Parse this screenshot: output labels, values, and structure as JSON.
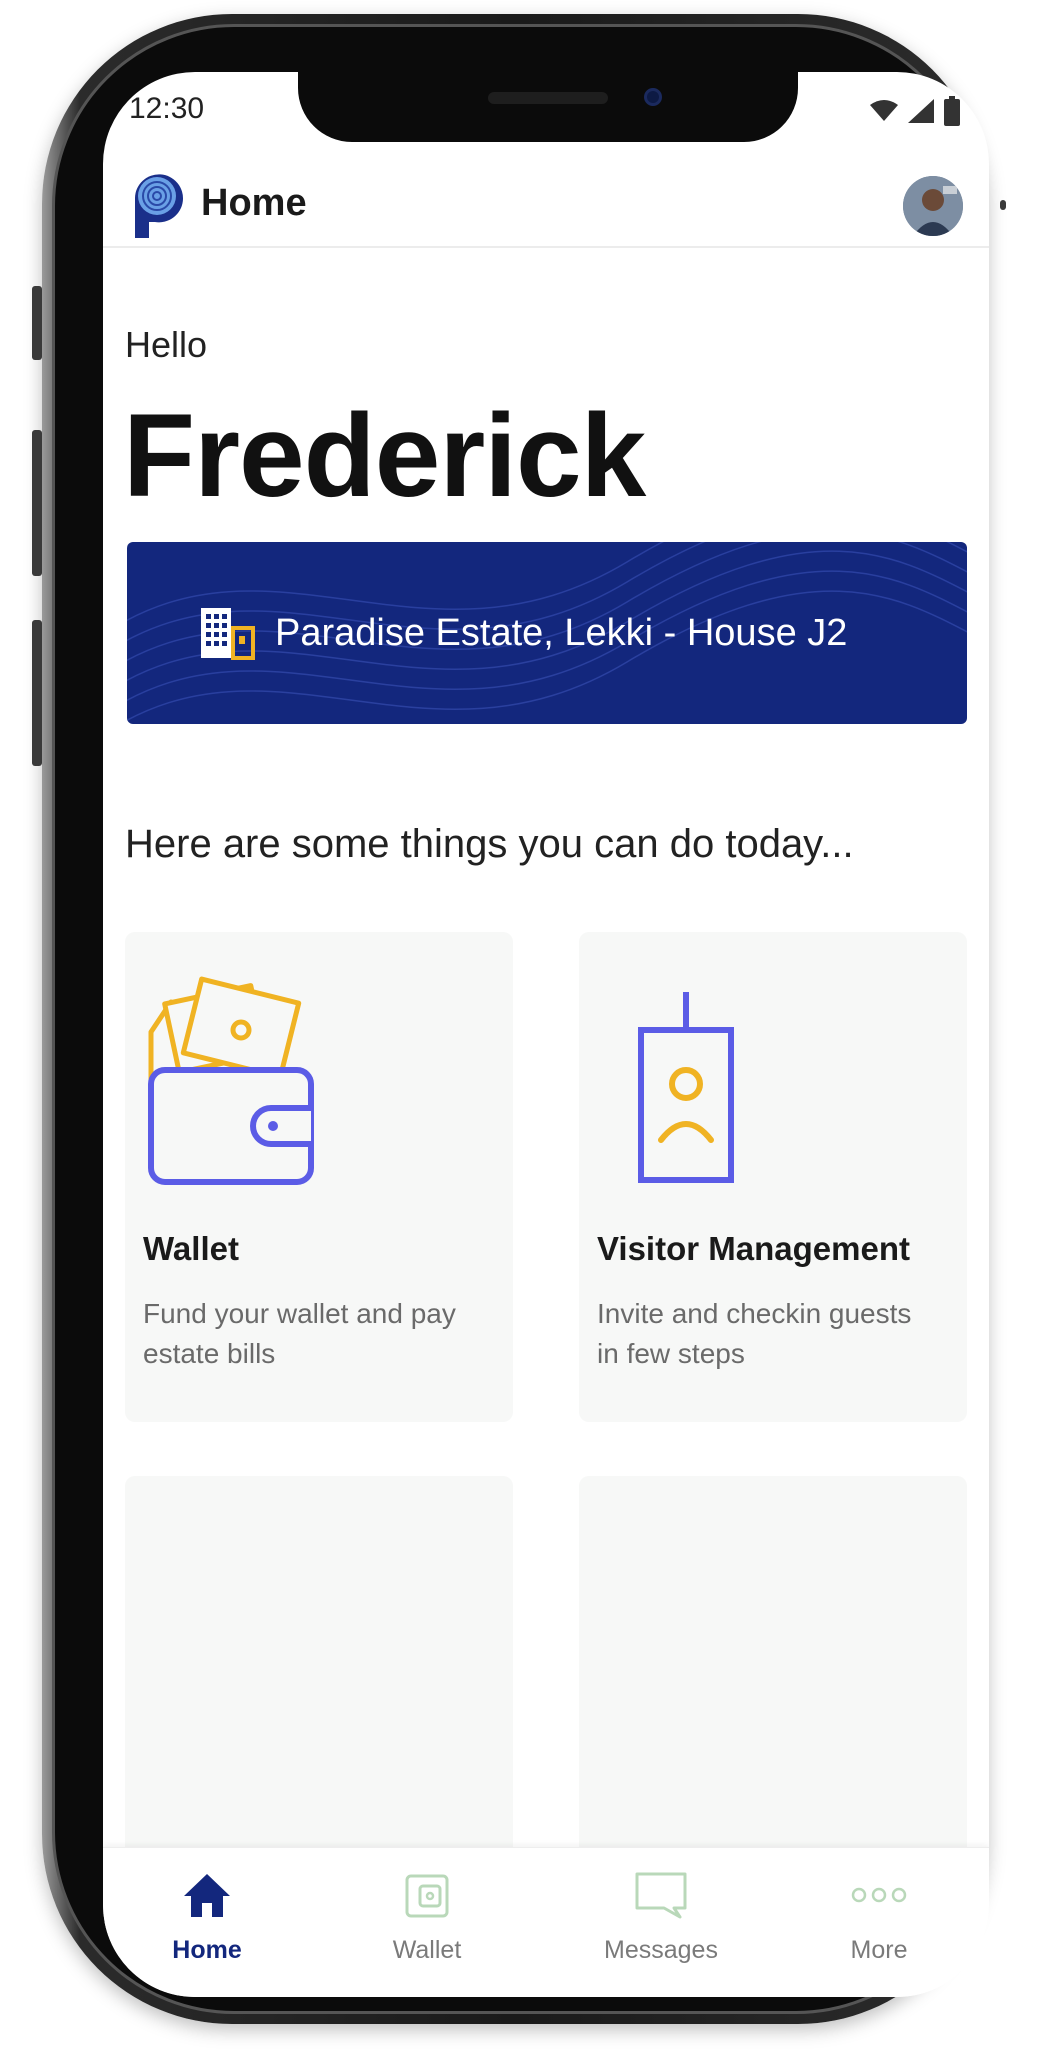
{
  "status_bar": {
    "time": "12:30"
  },
  "app_bar": {
    "title": "Home"
  },
  "greeting": {
    "hello": "Hello",
    "name": "Frederick"
  },
  "estate": {
    "label": "Paradise Estate, Lekki - House J2"
  },
  "subheading": "Here are some things you can do today...",
  "cards": [
    {
      "title": "Wallet",
      "description": "Fund your wallet and pay estate bills",
      "icon": "wallet-icon"
    },
    {
      "title": "Visitor Management",
      "description": "Invite and checkin guests in few steps",
      "icon": "id-badge-icon"
    }
  ],
  "bottom_nav": {
    "items": [
      {
        "label": "Home",
        "icon": "home-icon",
        "active": true
      },
      {
        "label": "Wallet",
        "icon": "wallet-icon",
        "active": false
      },
      {
        "label": "Messages",
        "icon": "message-icon",
        "active": false
      },
      {
        "label": "More",
        "icon": "more-icon",
        "active": false
      }
    ]
  },
  "colors": {
    "primary": "#13277d",
    "accent_yellow": "#f0b323",
    "accent_purple": "#5b5ce6",
    "inactive_green": "#b9d8b9"
  }
}
